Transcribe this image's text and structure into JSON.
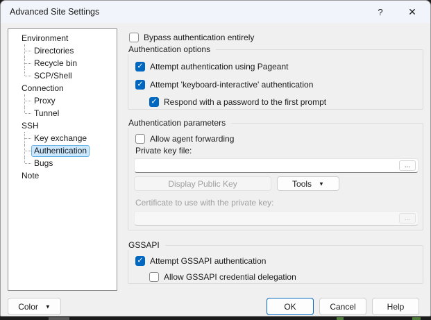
{
  "window": {
    "title": "Advanced Site Settings"
  },
  "icons": {
    "help": "?",
    "close": "✕",
    "check": "✓",
    "dropdown_arrow": "▼",
    "browse_ellipsis": "..."
  },
  "colors": {
    "accent": "#0067C0",
    "selection_bg": "#CCE8FF",
    "selection_border": "#66B0E6",
    "dialog_bg": "#F0F0F0",
    "titlebar_bg": "#F1F4FA"
  },
  "tree": {
    "items": [
      {
        "label": "Environment",
        "level": 0,
        "selected": false
      },
      {
        "label": "Directories",
        "level": 1,
        "selected": false
      },
      {
        "label": "Recycle bin",
        "level": 1,
        "selected": false
      },
      {
        "label": "SCP/Shell",
        "level": 1,
        "selected": false
      },
      {
        "label": "Connection",
        "level": 0,
        "selected": false
      },
      {
        "label": "Proxy",
        "level": 1,
        "selected": false
      },
      {
        "label": "Tunnel",
        "level": 1,
        "selected": false
      },
      {
        "label": "SSH",
        "level": 0,
        "selected": false
      },
      {
        "label": "Key exchange",
        "level": 1,
        "selected": false
      },
      {
        "label": "Authentication",
        "level": 1,
        "selected": true
      },
      {
        "label": "Bugs",
        "level": 1,
        "selected": false
      },
      {
        "label": "Note",
        "level": 0,
        "selected": false
      }
    ]
  },
  "main": {
    "bypass": {
      "label": "Bypass authentication entirely",
      "checked": false
    },
    "auth_options": {
      "title": "Authentication options",
      "pageant": {
        "label": "Attempt authentication using Pageant",
        "checked": true
      },
      "keyboard": {
        "label": "Attempt 'keyboard-interactive' authentication",
        "checked": true
      },
      "respond": {
        "label": "Respond with a password to the first prompt",
        "checked": true
      }
    },
    "auth_params": {
      "title": "Authentication parameters",
      "agent_forwarding": {
        "label": "Allow agent forwarding",
        "checked": false
      },
      "private_key_label": "Private key file:",
      "private_key_value": "",
      "display_public_key_label": "Display Public Key",
      "tools_label": "Tools",
      "certificate_label": "Certificate to use with the private key:",
      "certificate_value": ""
    },
    "gssapi": {
      "title": "GSSAPI",
      "attempt": {
        "label": "Attempt GSSAPI authentication",
        "checked": true
      },
      "delegation": {
        "label": "Allow GSSAPI credential delegation",
        "checked": false
      }
    }
  },
  "footer": {
    "color_label": "Color",
    "ok_label": "OK",
    "cancel_label": "Cancel",
    "help_label": "Help"
  }
}
